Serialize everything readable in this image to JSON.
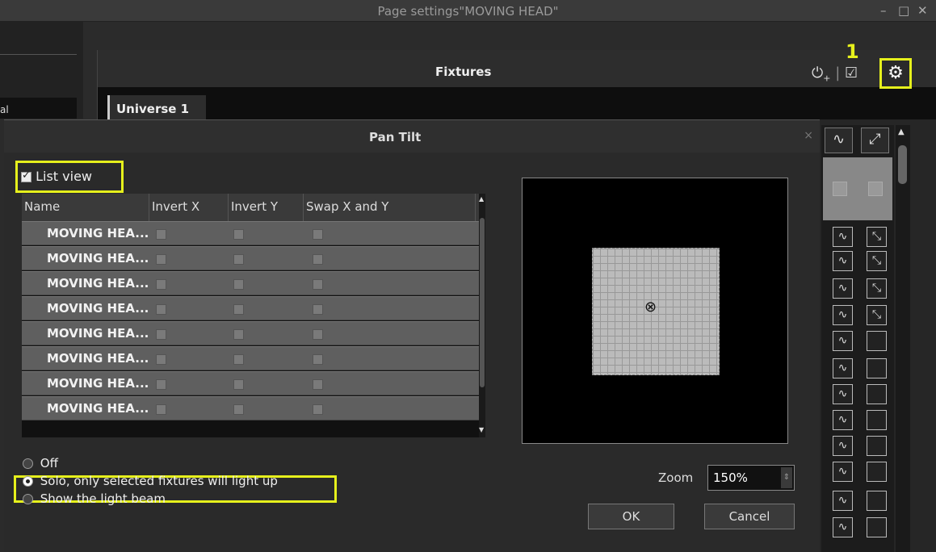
{
  "window": {
    "title": "Page settings\"MOVING HEAD\"",
    "minimize": "–",
    "maximize": "□",
    "close": "✕"
  },
  "background": {
    "left_label": "al"
  },
  "fixtures": {
    "title": "Fixtures",
    "tab": "Universe 1",
    "annotation_number": "1",
    "toolbar_icons": [
      "add-fixture-icon",
      "edit-icon",
      "gear-icon"
    ]
  },
  "dialog": {
    "title": "Pan Tilt",
    "close": "×",
    "list_view_label": "List view",
    "list_view_checked": true,
    "columns": [
      "Name",
      "Invert X",
      "Invert Y",
      "Swap X and Y"
    ],
    "rows": [
      {
        "name": "MOVING HEA...",
        "invert_x": false,
        "invert_y": false,
        "swap": false
      },
      {
        "name": "MOVING HEA...",
        "invert_x": false,
        "invert_y": false,
        "swap": false
      },
      {
        "name": "MOVING HEA...",
        "invert_x": false,
        "invert_y": false,
        "swap": false
      },
      {
        "name": "MOVING HEA...",
        "invert_x": false,
        "invert_y": false,
        "swap": false
      },
      {
        "name": "MOVING HEA...",
        "invert_x": false,
        "invert_y": false,
        "swap": false
      },
      {
        "name": "MOVING HEA...",
        "invert_x": false,
        "invert_y": false,
        "swap": false
      },
      {
        "name": "MOVING HEA...",
        "invert_x": false,
        "invert_y": false,
        "swap": false
      },
      {
        "name": "MOVING HEA...",
        "invert_x": false,
        "invert_y": false,
        "swap": false
      }
    ],
    "light_modes": [
      {
        "label": "Off",
        "selected": false
      },
      {
        "label": "Solo, only selected fixtures will light up",
        "selected": true
      },
      {
        "label": "Show the light beam",
        "selected": false
      }
    ],
    "zoom_label": "Zoom",
    "zoom_value": "150%",
    "ok_label": "OK",
    "cancel_label": "Cancel"
  },
  "colors": {
    "highlight": "#e6f01c",
    "row_bg": "#5f5f5f",
    "preview_bg": "#000000"
  }
}
